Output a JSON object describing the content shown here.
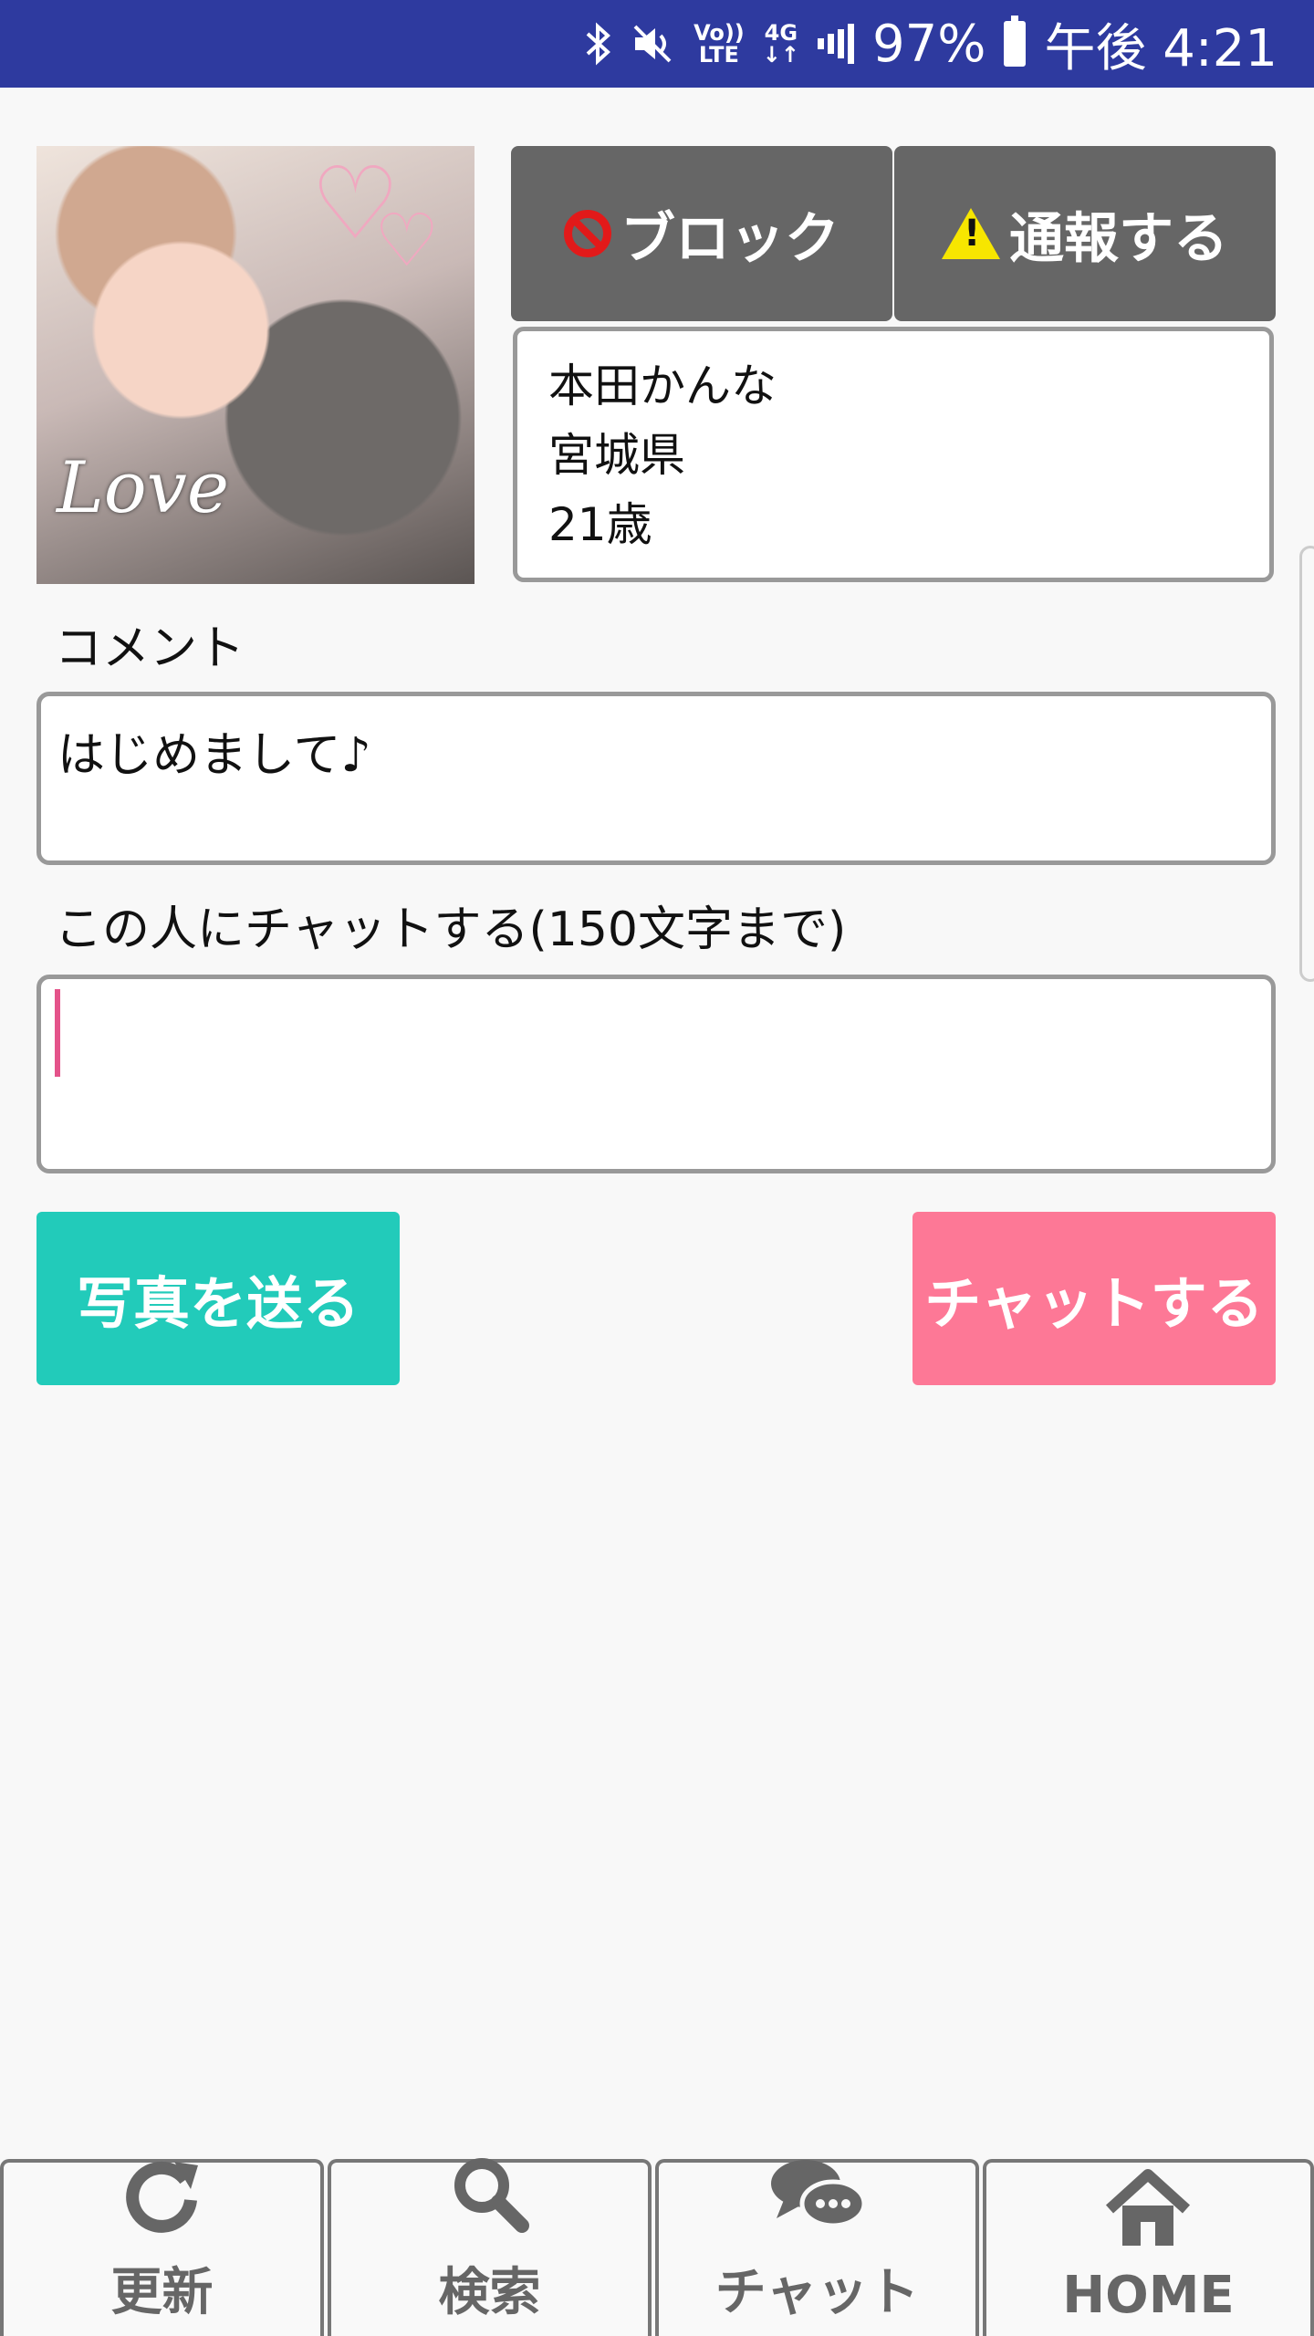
{
  "status_bar": {
    "bluetooth": "bluetooth-icon",
    "mute": "mute-icon",
    "volte_top": "Vo))",
    "volte_bottom": "LTE",
    "network_top": "4G",
    "network_bottom": "↓↑",
    "battery_percent": "97%",
    "time": "午後 4:21",
    "background_color": "#2e3a9f"
  },
  "profile": {
    "photo_text": "Love",
    "name": "本田かんな",
    "prefecture": "宮城県",
    "age": "21歳"
  },
  "actions": {
    "block_label": "ブロック",
    "report_label": "通報する",
    "button_color": "#666666"
  },
  "comment": {
    "label": "コメント",
    "text": "はじめまして♪"
  },
  "chat": {
    "label": "この人にチャットする(150文字まで)",
    "value": "",
    "send_photo_label": "写真を送る",
    "send_photo_color": "#22cbba",
    "send_chat_label": "チャットする",
    "send_chat_color": "#fd7896"
  },
  "tabbar": {
    "items": [
      {
        "label": "更新",
        "icon": "refresh-icon"
      },
      {
        "label": "検索",
        "icon": "search-icon"
      },
      {
        "label": "チャット",
        "icon": "chat-bubbles-icon"
      },
      {
        "label": "HOME",
        "icon": "home-icon"
      }
    ]
  }
}
